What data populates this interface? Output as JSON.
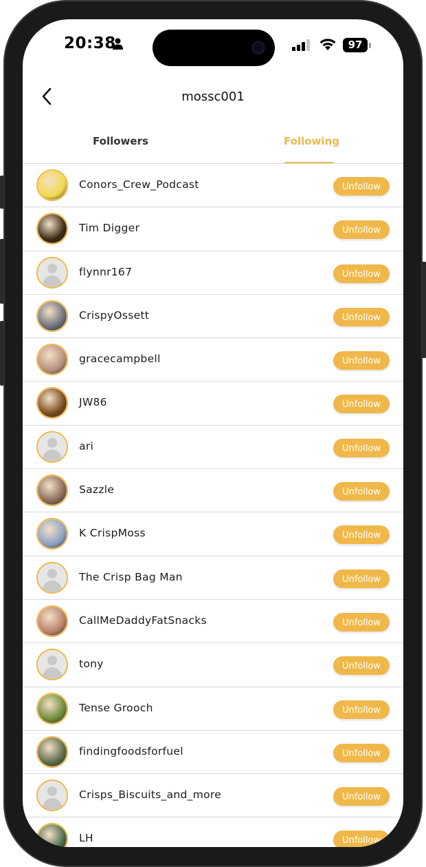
{
  "status_bar": {
    "time": "20:38",
    "battery": "97",
    "icons": [
      "person-icon",
      "signal-icon",
      "wifi-icon",
      "battery-icon"
    ]
  },
  "header": {
    "title": "mossc001",
    "back_icon": "chevron-left-icon"
  },
  "tabs": [
    {
      "label": "Followers",
      "active": false
    },
    {
      "label": "Following",
      "active": true
    }
  ],
  "colors": {
    "accent": "#f0b84a",
    "divider": "#d9d9d9",
    "text": "#1a1a1a"
  },
  "following": [
    {
      "name": "Conors_Crew_Podcast",
      "button": "Unfollow",
      "avatar": "photo",
      "avatar_color": "#f2d94e"
    },
    {
      "name": "Tim Digger",
      "button": "Unfollow",
      "avatar": "photo",
      "avatar_color": "#3a2a14"
    },
    {
      "name": "flynnr167",
      "button": "Unfollow",
      "avatar": "placeholder",
      "avatar_color": "#e6e6e6"
    },
    {
      "name": "CrispyOssett",
      "button": "Unfollow",
      "avatar": "photo",
      "avatar_color": "#6b6f7a"
    },
    {
      "name": "gracecampbell",
      "button": "Unfollow",
      "avatar": "photo",
      "avatar_color": "#b58f7c"
    },
    {
      "name": "JW86",
      "button": "Unfollow",
      "avatar": "photo",
      "avatar_color": "#7a4a1c"
    },
    {
      "name": "ari",
      "button": "Unfollow",
      "avatar": "placeholder",
      "avatar_color": "#e6e6e6"
    },
    {
      "name": "Sazzle",
      "button": "Unfollow",
      "avatar": "photo",
      "avatar_color": "#8a6a58"
    },
    {
      "name": "K CrispMoss",
      "button": "Unfollow",
      "avatar": "photo",
      "avatar_color": "#8aa0c4"
    },
    {
      "name": "The Crisp Bag Man",
      "button": "Unfollow",
      "avatar": "placeholder",
      "avatar_color": "#e6e6e6"
    },
    {
      "name": "CallMeDaddyFatSnacks",
      "button": "Unfollow",
      "avatar": "photo",
      "avatar_color": "#b8806a"
    },
    {
      "name": "tony",
      "button": "Unfollow",
      "avatar": "placeholder",
      "avatar_color": "#e6e6e6"
    },
    {
      "name": "Tense Grooch",
      "button": "Unfollow",
      "avatar": "photo",
      "avatar_color": "#6c8a3a"
    },
    {
      "name": "findingfoodsforfuel",
      "button": "Unfollow",
      "avatar": "photo",
      "avatar_color": "#5a6a4a"
    },
    {
      "name": "Crisps_Biscuits_and_more",
      "button": "Unfollow",
      "avatar": "placeholder",
      "avatar_color": "#e6e6e6"
    },
    {
      "name": "LH",
      "button": "Unfollow",
      "avatar": "photo",
      "avatar_color": "#4a6a4a"
    }
  ]
}
